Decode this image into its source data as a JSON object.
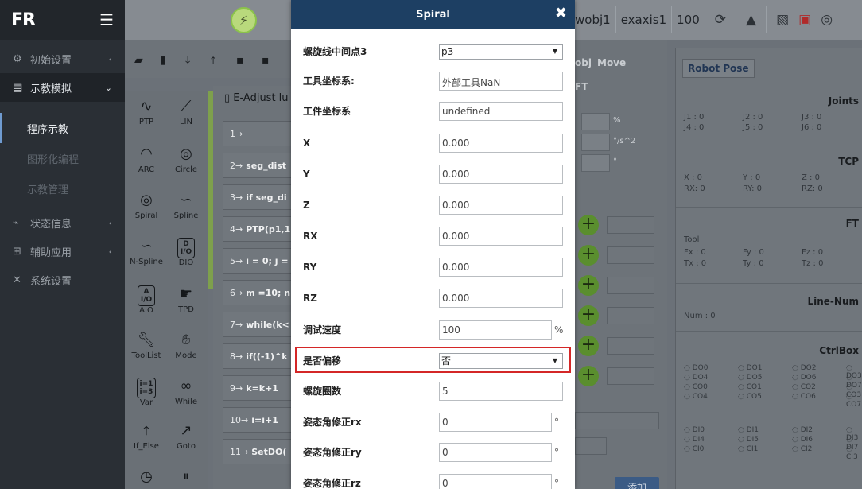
{
  "sidebar": {
    "logo": "FR",
    "items": [
      {
        "label": "初始设置",
        "icon": "gear-icon"
      },
      {
        "label": "示教模拟",
        "icon": "teach-icon"
      },
      {
        "label": "状态信息",
        "icon": "pulse-icon"
      },
      {
        "label": "辅助应用",
        "icon": "grid-icon"
      },
      {
        "label": "系统设置",
        "icon": "tools-icon"
      }
    ],
    "subitems": [
      "程序示教",
      "图形化编程",
      "示教管理"
    ]
  },
  "topbar": {
    "wobj": "wobj1",
    "exaxis": "exaxis1",
    "speed": "100"
  },
  "palette": {
    "items": [
      "PTP",
      "LIN",
      "ARC",
      "Circle",
      "Spiral",
      "Spline",
      "N-Spline",
      "DIO",
      "AIO",
      "TPD",
      "ToolList",
      "Mode",
      "Var",
      "While",
      "If_Else",
      "Goto"
    ],
    "box_dio": "D\nI/O",
    "box_aio": "A\nI/O"
  },
  "program": {
    "title": "E-Adjust lu",
    "lines": [
      {
        "n": "1→",
        "code": ""
      },
      {
        "n": "2→",
        "code": "seg_dist"
      },
      {
        "n": "3→",
        "code": "if seg_di"
      },
      {
        "n": "4→",
        "code": "PTP(p1,1"
      },
      {
        "n": "5→",
        "code": "i = 0; j ="
      },
      {
        "n": "6→",
        "code": "m =10; n"
      },
      {
        "n": "7→",
        "code": "while(k<"
      },
      {
        "n": "8→",
        "code": "if((-1)^k"
      },
      {
        "n": "9→",
        "code": "k=k+1"
      },
      {
        "n": "10→",
        "code": "i=i+1"
      },
      {
        "n": "11→",
        "code": "SetDO("
      }
    ]
  },
  "mid": {
    "tab1": "obj",
    "tab2": "Move",
    "tab3": "FT",
    "unit1": "%",
    "unit2": "°/s^2",
    "unit3": "°",
    "add_label": "添加"
  },
  "right": {
    "robot_pose": "Robot Pose",
    "joints": "Joints",
    "j_vals": [
      "J1 : 0",
      "J2 : 0",
      "J3 : 0",
      "J4 : 0",
      "J5 : 0",
      "J6 : 0"
    ],
    "tcp": "TCP",
    "tcp_vals": [
      "X : 0",
      "Y : 0",
      "Z : 0",
      "RX: 0",
      "RY: 0",
      "RZ: 0"
    ],
    "ft": "FT",
    "tool": "Tool",
    "ft_vals": [
      "Fx : 0",
      "Fy : 0",
      "Fz : 0",
      "Tx : 0",
      "Ty : 0",
      "Tz : 0"
    ],
    "line_num": "Line-Num",
    "num": "Num  :  0",
    "ctrlbox": "CtrlBox",
    "io": [
      "DO0",
      "DO1",
      "DO2",
      "DO3",
      "DO4",
      "DO5",
      "DO6",
      "DO7",
      "CO0",
      "CO1",
      "CO2",
      "CO3",
      "CO4",
      "CO5",
      "CO6",
      "CO7",
      "DI0",
      "DI1",
      "DI2",
      "DI3",
      "DI4",
      "DI5",
      "DI6",
      "DI7",
      "CI0",
      "CI1",
      "CI2",
      "CI3"
    ]
  },
  "modal": {
    "title": "Spiral",
    "close": "✖",
    "rows": [
      {
        "label": "螺旋线中间点3",
        "value": "p3",
        "type": "select"
      },
      {
        "label": "工具坐标系:",
        "value": "外部工具NaN",
        "type": "input"
      },
      {
        "label": "工件坐标系",
        "value": "undefined",
        "type": "input"
      },
      {
        "label": "X",
        "value": "0.000",
        "type": "input"
      },
      {
        "label": "Y",
        "value": "0.000",
        "type": "input"
      },
      {
        "label": "Z",
        "value": "0.000",
        "type": "input"
      },
      {
        "label": "RX",
        "value": "0.000",
        "type": "input"
      },
      {
        "label": "RY",
        "value": "0.000",
        "type": "input"
      },
      {
        "label": "RZ",
        "value": "0.000",
        "type": "input"
      },
      {
        "label": "调试速度",
        "value": "100",
        "type": "input",
        "unit": "%"
      },
      {
        "label": "是否偏移",
        "value": "否",
        "type": "select"
      },
      {
        "label": "螺旋圈数",
        "value": "5",
        "type": "input"
      },
      {
        "label": "姿态角修正rx",
        "value": "0",
        "type": "input",
        "unit": "°"
      },
      {
        "label": "姿态角修正ry",
        "value": "0",
        "type": "input",
        "unit": "°"
      },
      {
        "label": "姿态角修正rz",
        "value": "0",
        "type": "input",
        "unit": "°"
      }
    ]
  },
  "colors": {
    "modal_header": "#1d3f63",
    "highlight": "#d42727",
    "plus_green": "#5a8e2e"
  }
}
